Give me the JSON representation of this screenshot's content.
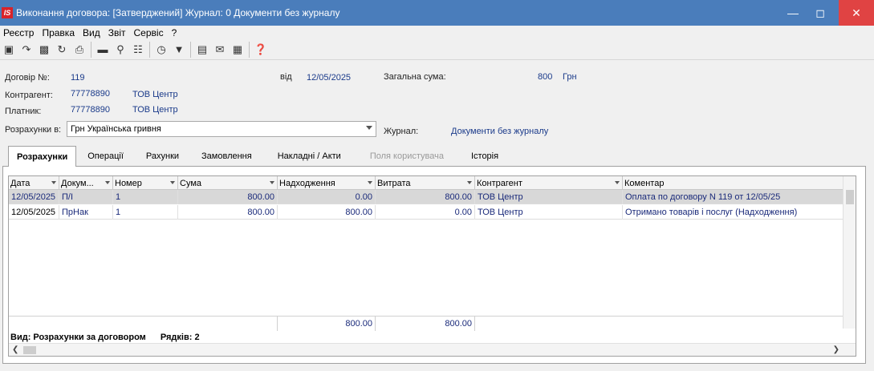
{
  "window": {
    "title": "Виконання договора: [Затверджений] Журнал: 0 Документи без журналу",
    "logo": "IS"
  },
  "menu": [
    "Реєстр",
    "Правка",
    "Вид",
    "Звіт",
    "Сервіс",
    "?"
  ],
  "toolbar_icons": [
    "copy-icon",
    "paste-icon",
    "duplicate-icon",
    "refresh-icon",
    "print-icon",
    "monitor-icon",
    "find-icon",
    "tree-icon",
    "clock-icon",
    "filter-icon",
    "document-icon",
    "mail-icon",
    "barcode-icon",
    "help-icon"
  ],
  "form": {
    "contract_label": "Договір  №:",
    "contract_no": "119",
    "date_label": "від",
    "date": "12/05/2025",
    "total_label": "Загальна сума:",
    "total_value": "800",
    "currency": "Грн",
    "contractor_label": "Контрагент:",
    "contractor_code": "77778890",
    "contractor_name": "ТОВ Центр",
    "payer_label": "Платник:",
    "payer_code": "77778890",
    "payer_name": "ТОВ Центр",
    "settlement_label": "Розрахунки в:",
    "settlement_value": "Грн Українська гривня",
    "journal_label": "Журнал:",
    "journal_value": "Документи без журналу"
  },
  "tabs": [
    {
      "label": "Розрахунки",
      "state": "active"
    },
    {
      "label": "Операції",
      "state": "normal"
    },
    {
      "label": "Рахунки",
      "state": "normal"
    },
    {
      "label": "Замовлення",
      "state": "normal"
    },
    {
      "label": "Накладні / Акти",
      "state": "normal"
    },
    {
      "label": "Поля користувача",
      "state": "disabled"
    },
    {
      "label": "Історія",
      "state": "normal"
    }
  ],
  "grid": {
    "columns": [
      "Дата",
      "Докум...",
      "Номер",
      "Сума",
      "Надходження",
      "Витрата",
      "Контрагент",
      "Коментар"
    ],
    "rows": [
      [
        "12/05/2025",
        "П/І",
        "1",
        "800.00",
        "0.00",
        "800.00",
        "ТОВ Центр",
        "Оплата по договору N 119 от 12/05/25"
      ],
      [
        "12/05/2025",
        "ПрНак",
        "1",
        "800.00",
        "800.00",
        "0.00",
        "ТОВ Центр",
        "Отримано товарів і послуг (Надходження)"
      ]
    ],
    "totals": {
      "income": "800.00",
      "expense": "800.00"
    },
    "status_view": "Вид: Розрахунки за договором",
    "status_rows": "Рядків: 2"
  },
  "colors": {
    "titlebar": "#4a7dbb",
    "close": "#e04343",
    "value_text": "#1a3a8a",
    "selected_row": "#d8d8d8"
  }
}
